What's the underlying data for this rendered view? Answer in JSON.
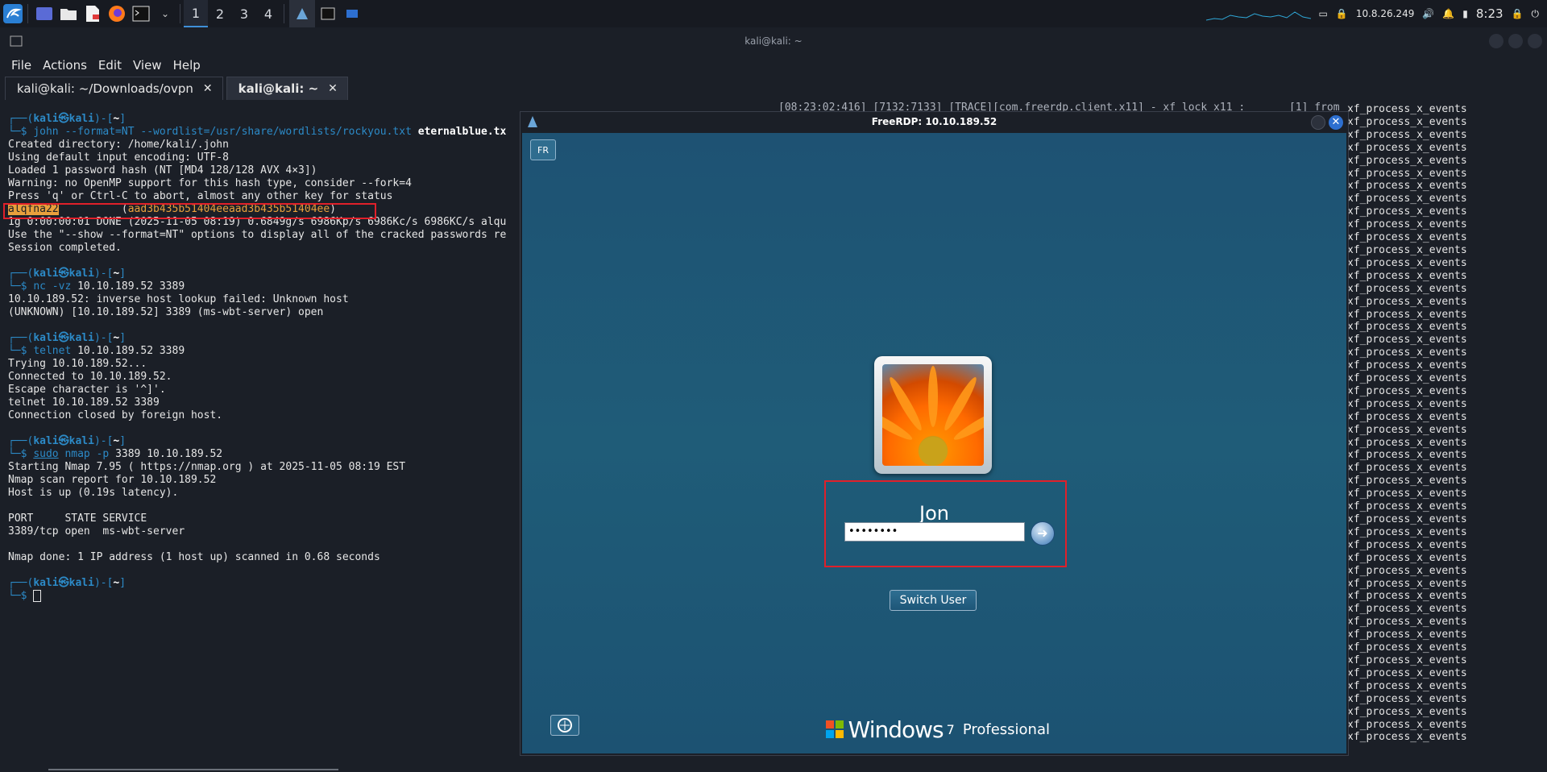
{
  "panel": {
    "workspaces": [
      "1",
      "2",
      "3",
      "4"
    ],
    "tray": {
      "ip": "10.8.26.249",
      "clock": "8:23"
    }
  },
  "terminal": {
    "title": "kali@kali: ~",
    "menu": [
      "File",
      "Actions",
      "Edit",
      "View",
      "Help"
    ],
    "tabs": [
      {
        "label": "kali@kali: ~/Downloads/ovpn",
        "close": "✕"
      },
      {
        "label": "kali@kali: ~",
        "close": "✕"
      }
    ],
    "prompt": {
      "top": "┌──(",
      "user": "kali㉿kali",
      "mid": ")-[",
      "dir": "~",
      "end": "]",
      "bottom": "└─$ "
    },
    "block1": {
      "cmd": "john --format=NT --wordlist=/usr/share/wordlists/rockyou.txt ",
      "file": "eternalblue.tx",
      "lines": [
        "Created directory: /home/kali/.john",
        "Using default input encoding: UTF-8",
        "Loaded 1 password hash (NT [MD4 128/128 AVX 4×3])",
        "Warning: no OpenMP support for this hash type, consider --fork=4",
        "Press 'q' or Ctrl-C to abort, almost any other key for status"
      ],
      "cracked_password": "alqfna22",
      "cracked_hash_open": "          (",
      "cracked_hash": "aad3b435b51404eeaad3b435b51404ee",
      "cracked_hash_close": ")",
      "after": [
        "1g 0:00:00:01 DONE (2025-11-05 08:19) 0.6849g/s 6986Kp/s 6986Kc/s 6986KC/s alqu",
        "Use the \"--show --format=NT\" options to display all of the cracked passwords re",
        "Session completed."
      ]
    },
    "block2": {
      "cmd": "nc -vz ",
      "args": "10.10.189.52 3389",
      "lines": [
        "10.10.189.52: inverse host lookup failed: Unknown host",
        "(UNKNOWN) [10.10.189.52] 3389 (ms-wbt-server) open"
      ]
    },
    "block3": {
      "cmd": "telnet ",
      "args": "10.10.189.52 3389",
      "lines": [
        "Trying 10.10.189.52...",
        "Connected to 10.10.189.52.",
        "Escape character is '^]'.",
        "telnet 10.10.189.52 3389",
        "Connection closed by foreign host."
      ]
    },
    "block4": {
      "sudo": "sudo",
      "cmd": " nmap -p ",
      "args": "3389 10.10.189.52",
      "lines": [
        "Starting Nmap 7.95 ( https://nmap.org ) at 2025-11-05 08:19 EST",
        "Nmap scan report for 10.10.189.52",
        "Host is up (0.19s latency).",
        "",
        "PORT     STATE SERVICE",
        "3389/tcp open  ms-wbt-server",
        "",
        "Nmap done: 1 IP address (1 host up) scanned in 0.68 seconds"
      ]
    },
    "toplog": "[08:23:02:416] [7132:7133] [TRACE][com.freerdp.client.x11] - xf_lock_x11 :       [1] from",
    "rightlog_entry": "xf_process_x_events",
    "rightlog_count": 50
  },
  "rdp": {
    "title": "FreeRDP: 10.10.189.52",
    "keyboard": "FR",
    "username": "Jon",
    "password_mask": "••••••••",
    "switch_user": "Switch User",
    "windows": "Windows",
    "version": "7",
    "edition": "Professional"
  }
}
